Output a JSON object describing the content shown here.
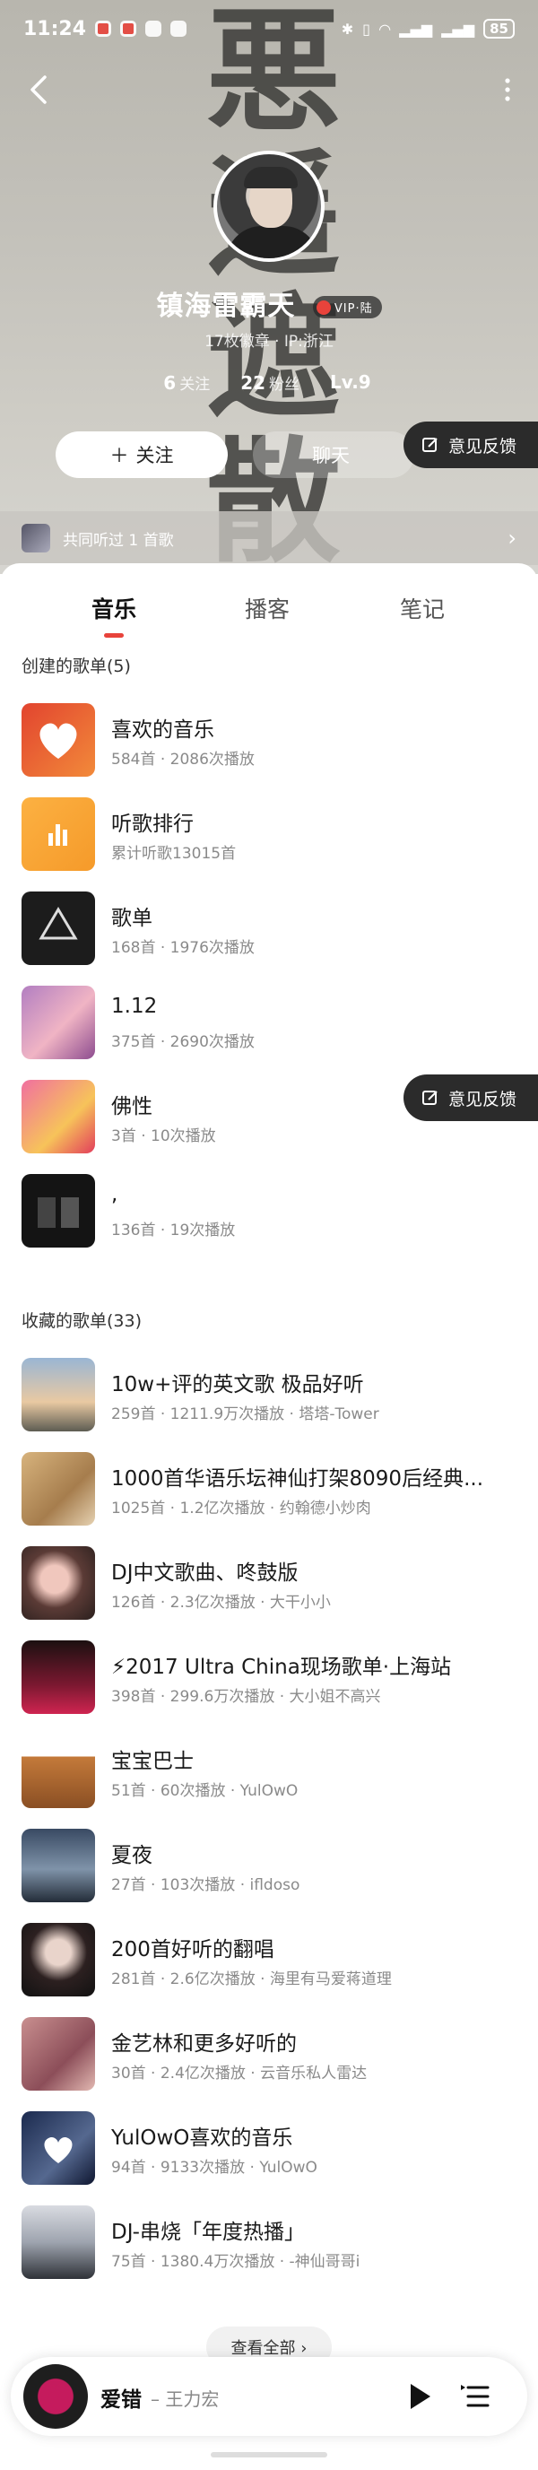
{
  "status_bar": {
    "time": "11:24",
    "battery": "85"
  },
  "profile": {
    "callig_chars": [
      "悪",
      "遥",
      "遮",
      "散"
    ],
    "username": "镇海雷霸天",
    "vip_badge": "VIP·陆",
    "meta": "17枚徽章 · IP:浙江",
    "stats": [
      {
        "value": "6",
        "label": "关注"
      },
      {
        "value": "22",
        "label": "粉丝"
      },
      {
        "value": "Lv.9",
        "label": ""
      }
    ],
    "follow_label": "关注",
    "chat_label": "聊天",
    "feedback_label": "意见反馈",
    "common_songs": "共同听过 1 首歌"
  },
  "tabs": [
    "音乐",
    "播客",
    "笔记"
  ],
  "created_title": "创建的歌单(5)",
  "created": [
    {
      "title": "喜欢的音乐",
      "sub": "584首 · 2086次播放"
    },
    {
      "title": "听歌排行",
      "sub": "累计听歌13015首"
    },
    {
      "title": "歌单",
      "sub": "168首 · 1976次播放"
    },
    {
      "title": "1.12",
      "sub": "375首 · 2690次播放"
    },
    {
      "title": "佛性",
      "sub": "3首 · 10次播放"
    },
    {
      "title": ",",
      "sub": "136首 · 19次播放"
    }
  ],
  "collected_title": "收藏的歌单(33)",
  "collected": [
    {
      "title": "10w+评的英文歌 极品好听",
      "sub": "259首 · 1211.9万次播放 · 塔塔-Tower"
    },
    {
      "title": "1000首华语乐坛神仙打架8090后经典...",
      "sub": "1025首 · 1.2亿次播放 · 约翰德小炒肉"
    },
    {
      "title": "DJ中文歌曲、咚鼓版",
      "sub": "126首 · 2.3亿次播放 · 大干小小"
    },
    {
      "title": "⚡2017 Ultra China现场歌单·上海站",
      "sub": "398首 · 299.6万次播放 · 大小姐不高兴"
    },
    {
      "title": "宝宝巴士",
      "sub": "51首 · 60次播放 · YulOwO"
    },
    {
      "title": "夏夜",
      "sub": "27首 · 103次播放 · ifldoso"
    },
    {
      "title": "200首好听的翻唱",
      "sub": "281首 · 2.6亿次播放 · 海里有马爱蒋道理"
    },
    {
      "title": "金艺林和更多好听的",
      "sub": "30首 · 2.4亿次播放 · 云音乐私人雷达"
    },
    {
      "title": "YulOwO喜欢的音乐",
      "sub": "94首 · 9133次播放 · YulOwO"
    },
    {
      "title": "DJ-串烧「年度热播」",
      "sub": "75首 · 1380.4万次播放 · -神仙哥哥i"
    }
  ],
  "see_all": "查看全部 ›",
  "player": {
    "song": "爱错",
    "artist": "– 王力宏"
  },
  "colors": {
    "accent": "#e8433b"
  }
}
